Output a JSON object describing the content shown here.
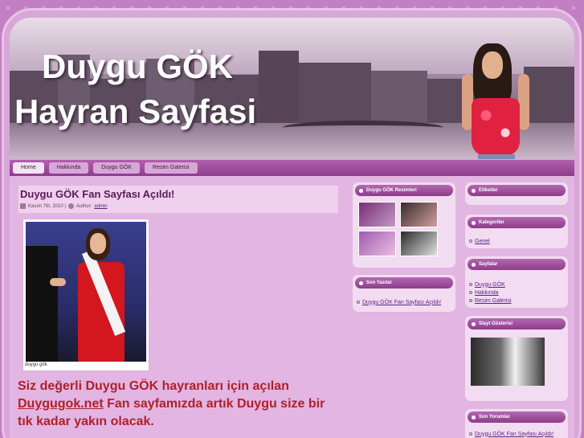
{
  "header": {
    "title_line1": "Duygu GÖK",
    "title_line2": "Hayran Sayfasi"
  },
  "nav": {
    "items": [
      {
        "label": "Home",
        "active": true
      },
      {
        "label": "Hakkında",
        "active": false
      },
      {
        "label": "Duygu GÖK",
        "active": false
      },
      {
        "label": "Resim Galerisi",
        "active": false
      }
    ]
  },
  "post": {
    "title": "Duygu GÖK Fan Sayfası Açıldı!",
    "date": "Kasım 7th, 2010 |",
    "author_label": "Author:",
    "author": "admin",
    "photo_caption": "duygu gök",
    "body_part1": "Siz değerli Duygu GÖK hayranları için açılan",
    "body_link": "Duygugok.net",
    "body_part2": " Fan sayfamızda  artık Duygu size bir tık kadar yakın olacak."
  },
  "sidebar_mid": {
    "resimler_title": "Duygu GÖK Resimleri",
    "son_yazilar_title": "Son Yazılar",
    "son_yazilar_items": [
      "Duygu GÖK Fan Sayfası Açıldı!"
    ]
  },
  "sidebar_right": {
    "etiketler_title": "Etiketler",
    "kategoriler_title": "Kategoriler",
    "kategoriler_items": [
      "Genel"
    ],
    "sayfalar_title": "Sayfalar",
    "sayfalar_items": [
      "Duygu GÖK",
      "Hakkında",
      "Resim Galerisi"
    ],
    "slayt_title": "Slayt Gösterisi",
    "son_yorumlar_title": "Son Yorumlar",
    "son_yorumlar_items": [
      "Duygu GÖK Fan Sayfası Açıldı!"
    ]
  },
  "colors": {
    "background": "#c27fc1",
    "title_text": "#5a1a5a",
    "accent_red": "#b0202a",
    "widget_header": "#8c3d8a"
  }
}
